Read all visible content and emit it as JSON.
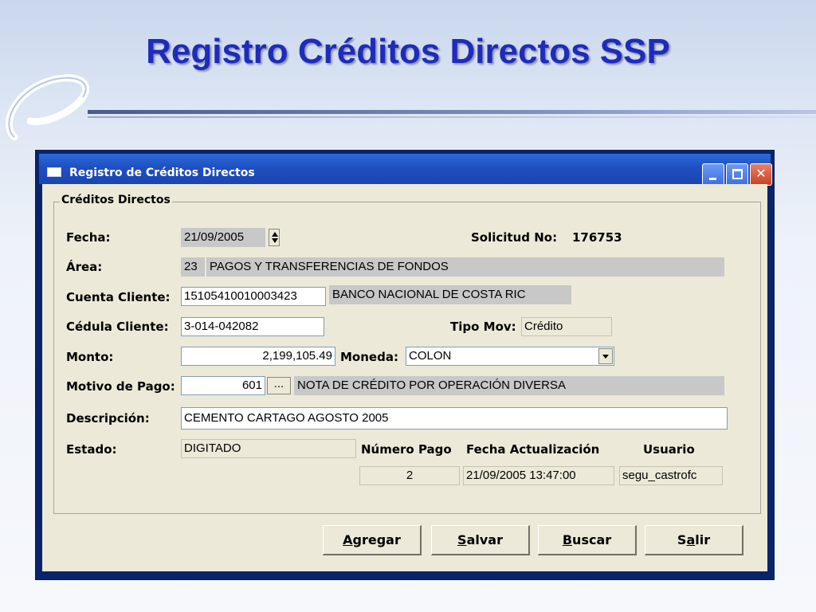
{
  "slide": {
    "title": "Registro Créditos Directos SSP"
  },
  "window": {
    "title": "Registro de Créditos Directos",
    "controls": {
      "minimize": "_",
      "maximize": "□",
      "close": "✕"
    }
  },
  "group": {
    "title": "Créditos Directos"
  },
  "form": {
    "fecha_label": "Fecha:",
    "fecha_value": "21/09/2005",
    "solicitud_label": "Solicitud No:",
    "solicitud_value": "176753",
    "area_label": "Área:",
    "area_code": "23",
    "area_name": "PAGOS Y TRANSFERENCIAS DE FONDOS",
    "cuenta_label": "Cuenta Cliente:",
    "cuenta_value": "15105410010003423",
    "cuenta_banco": "BANCO NACIONAL DE COSTA RIC",
    "cedula_label": "Cédula Cliente:",
    "cedula_value": "3-014-042082",
    "tipo_mov_label": "Tipo Mov:",
    "tipo_mov_value": "Crédito",
    "monto_label": "Monto:",
    "monto_value": "2,199,105.49",
    "moneda_label": "Moneda:",
    "moneda_value": "COLON",
    "motivo_label": "Motivo de Pago:",
    "motivo_code": "601",
    "motivo_btn": "...",
    "motivo_desc": "NOTA DE CRÉDITO POR OPERACIÓN DIVERSA",
    "descripcion_label": "Descripción:",
    "descripcion_value": "CEMENTO CARTAGO AGOSTO 2005",
    "estado_label": "Estado:",
    "estado_value": "DIGITADO",
    "numero_pago_label": "Número Pago",
    "numero_pago_value": "2",
    "fecha_act_label": "Fecha Actualización",
    "fecha_act_value": "21/09/2005 13:47:00",
    "usuario_label": "Usuario",
    "usuario_value": "segu_castrofc"
  },
  "buttons": {
    "agregar": {
      "mnemonic": "A",
      "rest": "gregar"
    },
    "salvar": {
      "mnemonic": "S",
      "rest": "alvar"
    },
    "buscar": {
      "mnemonic": "B",
      "rest": "uscar"
    },
    "salir": {
      "pre": "S",
      "mnemonic": "a",
      "rest": "lir"
    }
  },
  "colors": {
    "title_blue": "#1e2bbd",
    "window_frame": "#0a246a",
    "titlebar": "#1f4fc0",
    "client_bg": "#ece9d8",
    "readonly_grey": "#c8c8c8"
  }
}
